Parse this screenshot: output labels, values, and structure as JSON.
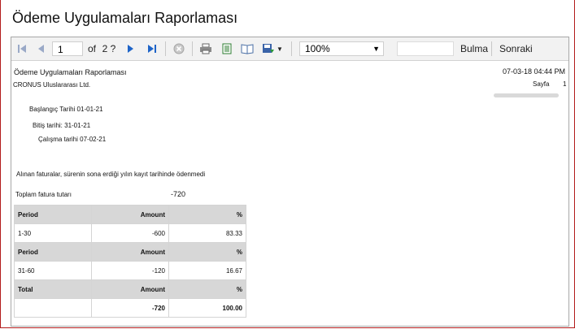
{
  "window": {
    "title": "Ödeme Uygulamaları Raporlaması"
  },
  "toolbar": {
    "page_current": "1",
    "page_of": "of",
    "page_total": "2 ?",
    "zoom": "100%",
    "find_label": "Bulma",
    "next_label": "Sonraki",
    "find_value": ""
  },
  "report": {
    "title": "Ödeme Uygulamaları Raporlaması",
    "company": "CRONUS Uluslararası Ltd.",
    "datetime": "07-03-18 04:44 PM",
    "page_label": "Sayfa",
    "page_number": "1",
    "start_date": "Başlangıç Tarihi 01-01-21",
    "end_date": "Bitiş tarihi: 31-01-21",
    "work_date": "Çalışma tarihi 07-02-21",
    "note": "Alınan faturalar, sürenin sona erdiği yılın kayıt tarihinde ödenmedi",
    "total_invoice_label": "Toplam fatura tutarı",
    "total_invoice_value": "-720",
    "table": [
      {
        "type": "header",
        "cells": [
          "Period",
          "Amount",
          "%"
        ]
      },
      {
        "type": "row",
        "cells": [
          "1-30",
          "-600",
          "83.33"
        ]
      },
      {
        "type": "header",
        "cells": [
          "Period",
          "Amount",
          "%"
        ]
      },
      {
        "type": "row",
        "cells": [
          "31-60",
          "-120",
          "16.67"
        ]
      },
      {
        "type": "header",
        "cells": [
          "Total",
          "Amount",
          "%"
        ]
      },
      {
        "type": "total",
        "cells": [
          "",
          "-720",
          "100.00"
        ]
      }
    ]
  },
  "icons": {
    "first": "first-page-icon",
    "prev": "previous-page-icon",
    "next": "next-page-icon",
    "last": "last-page-icon",
    "stop": "stop-icon",
    "print": "print-icon",
    "layout": "print-layout-icon",
    "setup": "page-setup-icon",
    "export": "export-icon"
  },
  "colors": {
    "accent": "#1e64c8",
    "frame": "#b31b1b",
    "header_bg": "#d7d7d7"
  }
}
